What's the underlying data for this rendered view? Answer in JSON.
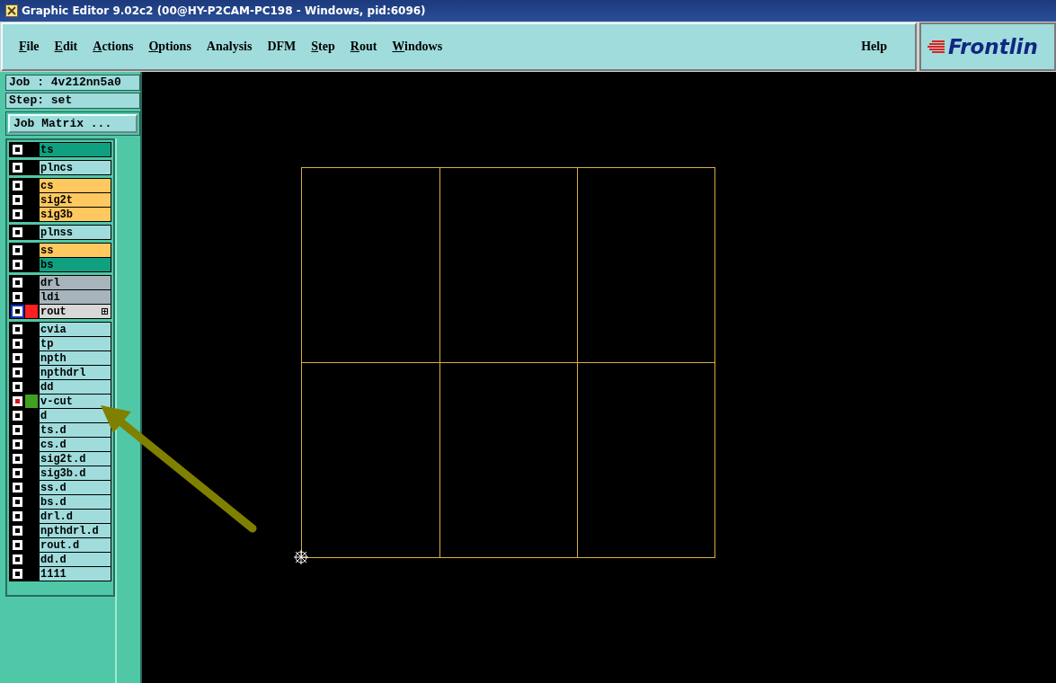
{
  "window": {
    "title": "Graphic Editor 9.02c2 (00@HY-P2CAM-PC198 - Windows, pid:6096)"
  },
  "menu": [
    {
      "label": "File",
      "underlined": true
    },
    {
      "label": "Edit",
      "underlined": true
    },
    {
      "label": "Actions",
      "underlined": true
    },
    {
      "label": "Options",
      "underlined": true
    },
    {
      "label": "Analysis",
      "underlined": false
    },
    {
      "label": "DFM",
      "underlined": false
    },
    {
      "label": "Step",
      "underlined": true
    },
    {
      "label": "Rout",
      "underlined": true
    },
    {
      "label": "Windows",
      "underlined": true
    }
  ],
  "help": "Help",
  "logo": "Frontlin",
  "job": "Job : 4v212nn5a0",
  "step": "Step: set",
  "job_matrix_button": "Job Matrix ...",
  "layer_groups": [
    [
      {
        "name": "ts",
        "color": "#10a080",
        "affected": false,
        "work": false,
        "expandable": false
      }
    ],
    [
      {
        "name": "plncs",
        "color": "#a0dcdc",
        "affected": false,
        "work": false,
        "expandable": false
      }
    ],
    [
      {
        "name": "cs",
        "color": "#ffc860",
        "affected": false,
        "work": false,
        "expandable": false
      },
      {
        "name": "sig2t",
        "color": "#ffc860",
        "affected": false,
        "work": false,
        "expandable": false
      },
      {
        "name": "sig3b",
        "color": "#ffc860",
        "affected": false,
        "work": false,
        "expandable": false
      }
    ],
    [
      {
        "name": "plnss",
        "color": "#a0dcdc",
        "affected": false,
        "work": false,
        "expandable": false
      }
    ],
    [
      {
        "name": "ss",
        "color": "#ffc860",
        "affected": false,
        "work": false,
        "expandable": false
      },
      {
        "name": "bs",
        "color": "#10a080",
        "affected": false,
        "work": false,
        "expandable": false
      }
    ],
    [
      {
        "name": "drl",
        "color": "#a8b4bc",
        "affected": false,
        "work": false,
        "expandable": false
      },
      {
        "name": "ldi",
        "color": "#a8b4bc",
        "affected": false,
        "work": false,
        "expandable": false
      },
      {
        "name": "rout",
        "color": "#d8d8d8",
        "affected": true,
        "work": false,
        "swatch": {
          "color": "#ff2020"
        },
        "expandable": true
      }
    ],
    [
      {
        "name": "cvia",
        "color": "#a0dcdc",
        "affected": false,
        "work": false,
        "expandable": false
      },
      {
        "name": "tp",
        "color": "#a0dcdc",
        "affected": false,
        "work": false,
        "expandable": false
      },
      {
        "name": "npth",
        "color": "#a0dcdc",
        "affected": false,
        "work": false,
        "expandable": false
      },
      {
        "name": "npthdrl",
        "color": "#a0dcdc",
        "affected": false,
        "work": false,
        "expandable": false
      },
      {
        "name": "dd",
        "color": "#a0dcdc",
        "affected": false,
        "work": false,
        "expandable": false
      },
      {
        "name": "v-cut",
        "color": "#a0dcdc",
        "affected": false,
        "work": true,
        "swatch": {
          "color": "#40a020"
        },
        "expandable": false
      },
      {
        "name": "d",
        "color": "#a0dcdc",
        "affected": false,
        "work": false,
        "expandable": false
      },
      {
        "name": "ts.d",
        "color": "#a0dcdc",
        "affected": false,
        "work": false,
        "expandable": false
      },
      {
        "name": "cs.d",
        "color": "#a0dcdc",
        "affected": false,
        "work": false,
        "expandable": false
      },
      {
        "name": "sig2t.d",
        "color": "#a0dcdc",
        "affected": false,
        "work": false,
        "expandable": false
      },
      {
        "name": "sig3b.d",
        "color": "#a0dcdc",
        "affected": false,
        "work": false,
        "expandable": false
      },
      {
        "name": "ss.d",
        "color": "#a0dcdc",
        "affected": false,
        "work": false,
        "expandable": false
      },
      {
        "name": "bs.d",
        "color": "#a0dcdc",
        "affected": false,
        "work": false,
        "expandable": false
      },
      {
        "name": "drl.d",
        "color": "#a0dcdc",
        "affected": false,
        "work": false,
        "expandable": false
      },
      {
        "name": "npthdrl.d",
        "color": "#a0dcdc",
        "affected": false,
        "work": false,
        "expandable": false
      },
      {
        "name": "rout.d",
        "color": "#a0dcdc",
        "affected": false,
        "work": false,
        "expandable": false
      },
      {
        "name": "dd.d",
        "color": "#a0dcdc",
        "affected": false,
        "work": false,
        "expandable": false
      },
      {
        "name": "1111",
        "color": "#a0dcdc",
        "affected": false,
        "work": false,
        "expandable": false
      }
    ]
  ]
}
